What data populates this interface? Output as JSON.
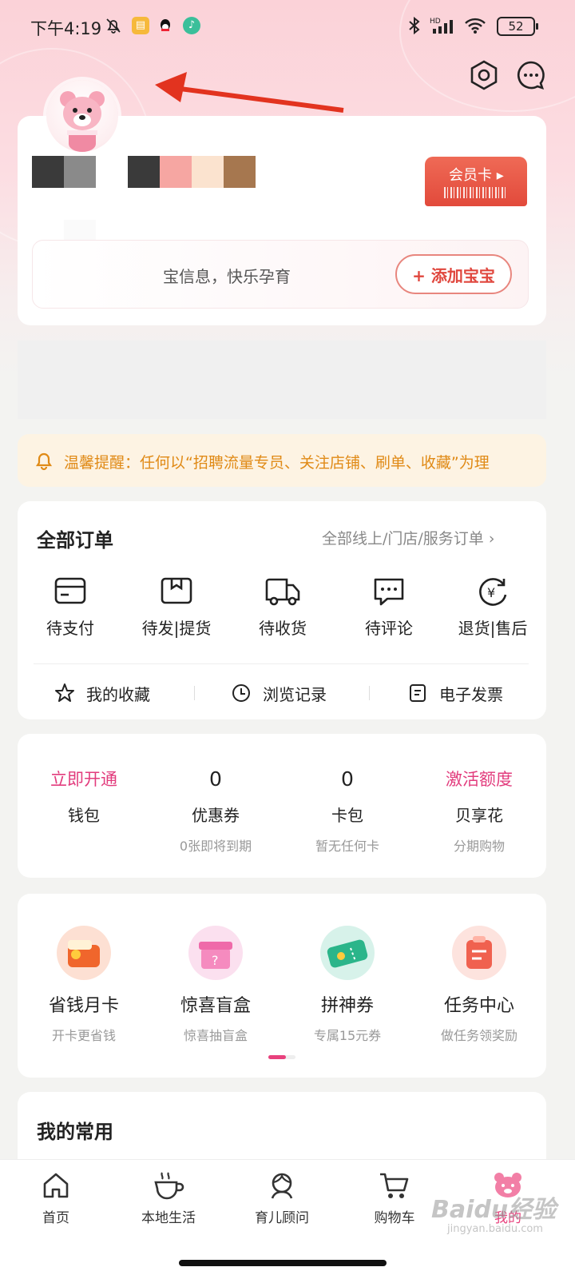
{
  "status_bar": {
    "time": "下午4:19",
    "battery": "52",
    "network_label": "HD"
  },
  "header": {
    "settings_icon": "settings-hex-icon",
    "message_icon": "chat-bubble-icon"
  },
  "profile": {
    "member_card_label": "会员卡 ▸",
    "baby_info_text": "宝信息，快乐孕育",
    "add_baby_label": "+ 添加宝宝"
  },
  "notice": {
    "text": "温馨提醒：任何以“招聘流量专员、关注店铺、刷单、收藏”为理"
  },
  "orders": {
    "title": "全部订单",
    "link": "全部线上/门店/服务订单 ›",
    "items": [
      {
        "label": "待支付",
        "icon": "card-icon"
      },
      {
        "label": "待发|提货",
        "icon": "box-icon"
      },
      {
        "label": "待收货",
        "icon": "truck-icon"
      },
      {
        "label": "待评论",
        "icon": "comment-icon"
      },
      {
        "label": "退货|售后",
        "icon": "refund-icon"
      }
    ],
    "quick": [
      {
        "label": "我的收藏",
        "icon": "star-icon"
      },
      {
        "label": "浏览记录",
        "icon": "clock-icon"
      },
      {
        "label": "电子发票",
        "icon": "invoice-icon"
      }
    ]
  },
  "wallet": [
    {
      "top": "立即开通",
      "label": "钱包",
      "sub": ""
    },
    {
      "top": "0",
      "label": "优惠券",
      "sub": "0张即将到期"
    },
    {
      "top": "0",
      "label": "卡包",
      "sub": "暂无任何卡"
    },
    {
      "top": "激活额度",
      "label": "贝享花",
      "sub": "分期购物"
    }
  ],
  "promos": [
    {
      "name": "省钱月卡",
      "desc": "开卡更省钱",
      "icon": "wallet-icon"
    },
    {
      "name": "惊喜盲盒",
      "desc": "惊喜抽盲盒",
      "icon": "gift-box-icon"
    },
    {
      "name": "拼神券",
      "desc": "专属15元券",
      "icon": "coupon-icon"
    },
    {
      "name": "任务中心",
      "desc": "做任务领奖励",
      "icon": "task-icon"
    }
  ],
  "common": {
    "title": "我的常用"
  },
  "nav": [
    {
      "label": "首页",
      "icon": "home-icon"
    },
    {
      "label": "本地生活",
      "icon": "coffee-icon"
    },
    {
      "label": "育儿顾问",
      "icon": "advisor-icon"
    },
    {
      "label": "购物车",
      "icon": "cart-icon"
    },
    {
      "label": "我的",
      "icon": "bear-icon"
    }
  ],
  "watermark": {
    "brand": "Baidu经验",
    "url": "jingyan.baidu.com"
  },
  "colors": {
    "accent_pink": "#e8417d",
    "accent_red": "#e24a3b",
    "notice_orange": "#e08a16"
  }
}
